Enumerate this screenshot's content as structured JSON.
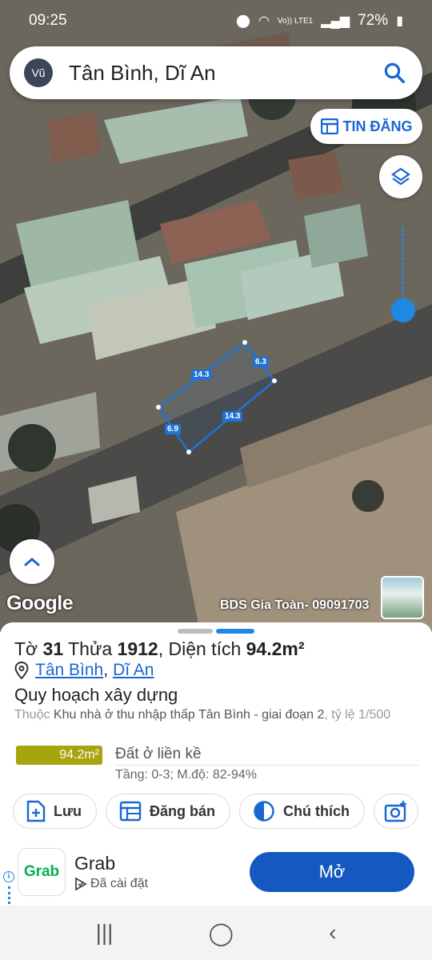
{
  "status": {
    "time": "09:25",
    "battery": "72%",
    "carrier": "Vo)) LTE1"
  },
  "search": {
    "avatar": "Vũ",
    "query": "Tân Bình, Dĩ An",
    "icon": "search-icon"
  },
  "map": {
    "tin_dang_label": "TIN ĐĂNG",
    "google_logo": "Google",
    "ad_label": "BDS Gia Toàn- 09091703",
    "dimensions": {
      "top": "14.3",
      "right": "6.3",
      "bottom": "14.3",
      "left": "6.9"
    }
  },
  "parcel": {
    "to_label": "Tờ",
    "to_value": "31",
    "thua_label": "Thửa",
    "thua_value": "1912",
    "dien_tich_label": ", Diện tích",
    "dien_tich_value": "94.2m²",
    "ward": "Tân Bình",
    "separator": ",",
    "district": "Dĩ An",
    "planning_title": "Quy hoạch xây dựng",
    "thuoc_label": "Thuộc",
    "zone_name": "Khu nhà ở thu nhập thấp Tân Bình - giai đoạn 2",
    "ty_le": ", tỷ lệ 1/500",
    "area_badge": "94.2m²",
    "land_type": "Đất ở liền kề",
    "floors": "Tầng: 0-3; M.độ: 82-94%",
    "land_color": "#a7a40d"
  },
  "actions": [
    {
      "label": "Lưu",
      "icon": "add-file-icon"
    },
    {
      "label": "Đăng bán",
      "icon": "listing-icon"
    },
    {
      "label": "Chú thích",
      "icon": "legend-icon"
    },
    {
      "label": "",
      "icon": "camera-add-icon"
    }
  ],
  "ad": {
    "app_name": "Grab",
    "installed": "Đã cài đặt",
    "button": "Mở",
    "logo_text": "Grab"
  },
  "nav": {
    "recent": "|||",
    "home": "◯",
    "back": "‹"
  },
  "colors": {
    "accent": "#1967d2",
    "parcel_outline": "#1e73d8",
    "open_button": "#1558c0"
  }
}
